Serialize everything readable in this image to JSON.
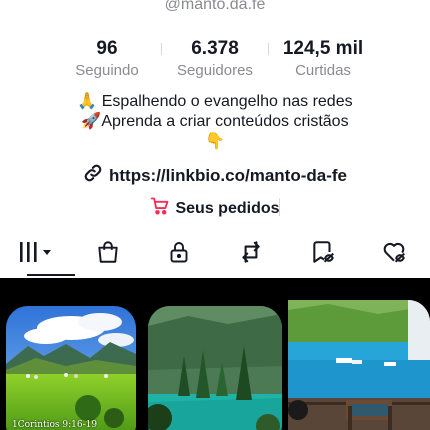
{
  "profile": {
    "handle": "@manto.da.fe",
    "stats": [
      {
        "value": "96",
        "label": "Seguindo"
      },
      {
        "value": "6.378",
        "label": "Seguidores"
      },
      {
        "value": "124,5 mil",
        "label": "Curtidas"
      }
    ],
    "bio": {
      "line1": "🙏 Espalhendo o evangelho nas redes",
      "line2": "🚀Aprenda a criar conteúdos cristãos",
      "line3": "👇"
    },
    "link": "https://linkbio.co/manto-da-fe",
    "orders_label": "Seus pedidos"
  },
  "tabs": [
    {
      "icon": "videos-grid-icon",
      "active": true
    },
    {
      "icon": "shopping-bag-icon",
      "active": false
    },
    {
      "icon": "lock-icon",
      "active": false
    },
    {
      "icon": "repost-icon",
      "active": false
    },
    {
      "icon": "favorites-icon",
      "active": false
    },
    {
      "icon": "liked-icon",
      "active": false
    }
  ],
  "videos": [
    {
      "caption": "1Corintios 9:16-19"
    },
    {
      "caption": ""
    },
    {
      "caption": ""
    }
  ],
  "colors": {
    "text": "#161823",
    "secondary": "#8a8b91",
    "accent": "#fe2c55"
  }
}
